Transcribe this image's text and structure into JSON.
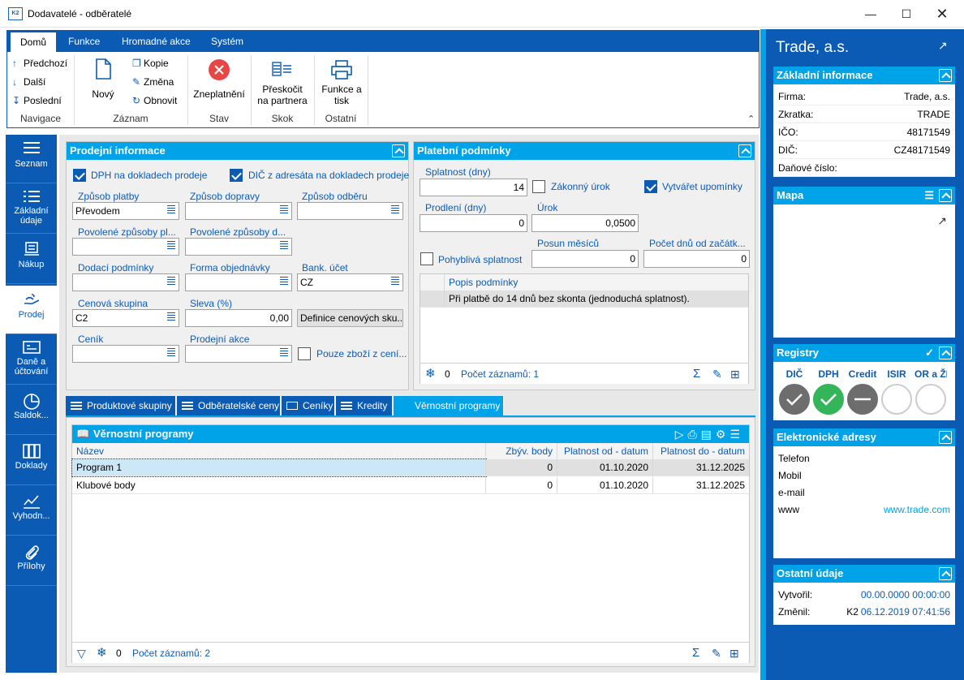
{
  "window": {
    "title": "Dodavatelé - odběratelé",
    "app_icon": "K2"
  },
  "ribbon": {
    "tabs": [
      "Domů",
      "Funkce",
      "Hromadné akce",
      "Systém"
    ],
    "navigace": {
      "items": [
        "Předchozí",
        "Další",
        "Poslední"
      ],
      "label": "Navigace"
    },
    "zaznam": {
      "novy": "Nový",
      "kopie": "Kopie",
      "zmena": "Změna",
      "obnovit": "Obnovit",
      "label": "Záznam"
    },
    "stav": {
      "zneplatneni": "Zneplatnění",
      "label": "Stav"
    },
    "skok": {
      "preskocit": "Přeskočit",
      "preskocit2": "na partnera",
      "label": "Skok"
    },
    "ostatni": {
      "funkce": "Funkce a",
      "funkce2": "tisk",
      "label": "Ostatní"
    }
  },
  "leftnav": [
    "Seznam",
    "Základní",
    "údaje",
    "Nákup",
    "Prodej",
    "Daně a",
    "účtování",
    "Saldok...",
    "Doklady",
    "Vyhodn...",
    "Přílohy"
  ],
  "prodejni": {
    "title": "Prodejní informace",
    "chk_dph": "DPH na dokladech prodeje",
    "chk_dic": "DIČ z adresáta na dokladech prodeje",
    "zpusob_platby": {
      "label": "Způsob platby",
      "value": "Převodem"
    },
    "zpusob_dopravy": {
      "label": "Způsob dopravy",
      "value": ""
    },
    "zpusob_odberu": {
      "label": "Způsob odběru",
      "value": ""
    },
    "povolene_platby": {
      "label": "Povolené způsoby pl...",
      "value": ""
    },
    "povolene_dopravy": {
      "label": "Povolené způsoby d...",
      "value": ""
    },
    "dodaci": {
      "label": "Dodací podmínky",
      "value": ""
    },
    "forma": {
      "label": "Forma objednávky",
      "value": ""
    },
    "bank": {
      "label": "Bank. účet",
      "value": "CZ"
    },
    "cenova": {
      "label": "Cenová skupina",
      "value": "C2"
    },
    "sleva": {
      "label": "Sleva (%)",
      "value": "0,00"
    },
    "definice_btn": "Definice cenových sku...",
    "cenik": {
      "label": "Ceník",
      "value": ""
    },
    "akce": {
      "label": "Prodejní akce",
      "value": ""
    },
    "chk_pouze": "Pouze zboží z cení..."
  },
  "platebni": {
    "title": "Platební podmínky",
    "splatnost": {
      "label": "Splatnost (dny)",
      "value": "14"
    },
    "zakonny": "Zákonný úrok",
    "upominky": "Vytvářet upomínky",
    "prodleni": {
      "label": "Prodlení (dny)",
      "value": "0"
    },
    "urok": {
      "label": "Úrok",
      "value": "0,0500"
    },
    "pohybliva": "Pohyblivá splatnost",
    "posun": {
      "label": "Posun měsíců",
      "value": "0"
    },
    "pocet_dnu": {
      "label": "Počet dnů od začátk...",
      "value": "0"
    },
    "grid_header": "Popis podmínky",
    "grid_row": "Při platbě do 14 dnů bez skonta (jednoduchá splatnost).",
    "footer_count": "0",
    "footer_text": "Počet záznamů: 1"
  },
  "bottom_tabs": [
    "Produktové skupiny",
    "Odběratelské ceny",
    "Ceníky",
    "Kredity",
    "Věrnostní programy"
  ],
  "vernostni": {
    "title": "Věrnostní programy",
    "columns": [
      "Název",
      "Zbýv. body",
      "Platnost od - datum",
      "Platnost do - datum"
    ],
    "rows": [
      [
        "Program 1",
        "0",
        "01.10.2020",
        "31.12.2025"
      ],
      [
        "Klubové body",
        "0",
        "01.10.2020",
        "31.12.2025"
      ]
    ],
    "footer_count": "0",
    "footer_text": "Počet záznamů: 2"
  },
  "right": {
    "company": "Trade, a.s.",
    "zakladni": {
      "title": "Základní informace",
      "rows": [
        [
          "Firma:",
          "Trade, a.s."
        ],
        [
          "Zkratka:",
          "TRADE"
        ],
        [
          "IČO:",
          "48171549"
        ],
        [
          "DIČ:",
          "CZ48171549"
        ],
        [
          "Daňové číslo:",
          ""
        ]
      ]
    },
    "mapa": {
      "title": "Mapa"
    },
    "registry": {
      "title": "Registry",
      "items": [
        "DIČ",
        "DPH",
        "Credit",
        "ISIR",
        "OR a ŽR"
      ]
    },
    "elektronicke": {
      "title": "Elektronické adresy",
      "rows": [
        [
          "Telefon",
          ""
        ],
        [
          "Mobil",
          ""
        ],
        [
          "e-mail",
          ""
        ],
        [
          "www",
          "www.trade.com"
        ]
      ]
    },
    "ostatni": {
      "title": "Ostatní údaje",
      "vytvoril": {
        "label": "Vytvořil:",
        "value": "00.00.0000 00:00:00"
      },
      "zmenil": {
        "label": "Změnil:",
        "user": "K2",
        "value": "06.12.2019 07:41:56"
      }
    }
  },
  "colors": {
    "brand": "#0b5bb5",
    "accent": "#00a2e8",
    "ok": "#35b55a",
    "gray": "#6d6d6d"
  }
}
